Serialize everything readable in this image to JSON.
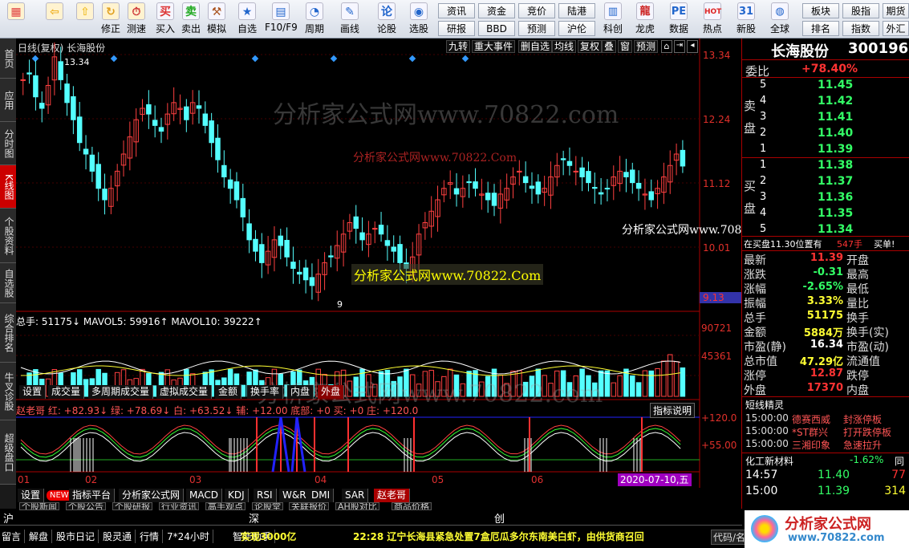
{
  "toolbar": {
    "buttons": [
      {
        "label": "",
        "icon": "app-grid-icon"
      },
      {
        "label": "",
        "icon": "back-arrow-icon"
      },
      {
        "label": "",
        "icon": "up-arrow-icon"
      },
      {
        "label": "修正",
        "icon": "refresh-icon"
      },
      {
        "label": "测速",
        "icon": "stopwatch-icon"
      },
      {
        "label": "买入",
        "icon": "buy-icon"
      },
      {
        "label": "卖出",
        "icon": "sell-icon"
      },
      {
        "label": "模拟",
        "icon": "gavel-icon"
      },
      {
        "label": "自选",
        "icon": "star-icon"
      },
      {
        "label": "F10/F9",
        "icon": "f10-icon"
      },
      {
        "label": "周期",
        "icon": "period-icon"
      },
      {
        "label": "画线",
        "icon": "pencil-icon"
      },
      {
        "label": "论股",
        "icon": "forum-icon"
      },
      {
        "label": "选股",
        "icon": "select-stock-icon"
      }
    ],
    "small_buttons": [
      "资讯",
      "资金",
      "竞价",
      "陆港",
      "研报",
      "BBD",
      "预测",
      "沪伦"
    ],
    "buttons2": [
      {
        "label": "科创",
        "icon": "chart-icon"
      },
      {
        "label": "龙虎",
        "icon": "dragon-icon"
      },
      {
        "label": "数据",
        "icon": "pe-icon"
      },
      {
        "label": "热点",
        "icon": "hot-icon"
      },
      {
        "label": "新股",
        "icon": "calendar-icon"
      },
      {
        "label": "全球",
        "icon": "globe-icon"
      }
    ],
    "small_buttons2": [
      "板块",
      "股指",
      "期货",
      "排名",
      "指数",
      "外汇"
    ]
  },
  "left_tabs": [
    "首页",
    "应用",
    "分时图",
    "K线图",
    "个股资料",
    "自选股",
    "综合排名",
    "牛叉诊股",
    "超级盘口"
  ],
  "chart": {
    "header_left": "日线(复权)  长海股份",
    "top_tabs": [
      "九转",
      "重大事件",
      "删自选",
      "均线",
      "复权",
      "叠",
      "窗",
      "预测"
    ],
    "price_axis": [
      "13.34",
      "12.24",
      "11.12",
      "10.01",
      "9.13"
    ],
    "volume_axis": [
      "90721",
      "45361"
    ],
    "indicator_axis": [
      "+120.0",
      "+55.00"
    ],
    "high_label": "13.34",
    "low_label": "9",
    "current_price_tag": "9.13",
    "vol_header": "总手: 51175↓  MAVOL5: 59916↑  MAVOL10: 39222↑",
    "vol_tabs": [
      "设置",
      "成交量",
      "多周期成交量",
      "虚拟成交量",
      "金额",
      "换手率",
      "内盘",
      "外盘"
    ],
    "ind_header": "赵老哥 红: +82.93↓ 绿: +78.69↓ 白: +63.52↓ 辅: +12.00 底部: +0 买: +0 庄: +120.0",
    "ind_help": "指标说明",
    "date_axis": [
      "01",
      "02",
      "03",
      "04",
      "05",
      "06"
    ],
    "date_tag": "2020-07-10,五",
    "bottom_tabs": [
      "设置",
      "NEW",
      "指标平台",
      "分析家公式网",
      "MACD",
      "KDJ",
      "RSI",
      "W&R",
      "DMI",
      "SAR",
      "赵老哥"
    ],
    "watermarks": [
      "分析家公式网www.70822.com",
      "分析家公式网www.70822.Com",
      "分析家公式网www.70822.Com",
      "分析家公式网www.70822.Com",
      "分析家公式网www.70822.com"
    ]
  },
  "panel": {
    "title": "长海股份",
    "code": "300196",
    "weibi_label": "委比",
    "weibi_value": "+78.40%",
    "sell_label": "卖盘",
    "buy_label": "买盘",
    "sells": [
      {
        "n": "5",
        "p": "11.45"
      },
      {
        "n": "4",
        "p": "11.42"
      },
      {
        "n": "3",
        "p": "11.41"
      },
      {
        "n": "2",
        "p": "11.40"
      },
      {
        "n": "1",
        "p": "11.39"
      }
    ],
    "buys": [
      {
        "n": "1",
        "p": "11.38"
      },
      {
        "n": "2",
        "p": "11.37"
      },
      {
        "n": "3",
        "p": "11.36"
      },
      {
        "n": "4",
        "p": "11.35"
      },
      {
        "n": "5",
        "p": "11.34"
      }
    ],
    "notice": "在买盘11.30位置有",
    "notice_qty": "547手",
    "notice_action": "买单!",
    "stats": [
      {
        "l": "最新",
        "v": "11.39",
        "r": "开盘"
      },
      {
        "l": "涨跌",
        "v": "-0.31",
        "r": "最高"
      },
      {
        "l": "涨幅",
        "v": "-2.65%",
        "r": "最低"
      },
      {
        "l": "振幅",
        "v": "3.33%",
        "r": "量比"
      },
      {
        "l": "总手",
        "v": "51175",
        "r": "换手"
      },
      {
        "l": "金额",
        "v": "5884万",
        "r": "换手(实)"
      },
      {
        "l": "市盈(静)",
        "v": "16.34",
        "r": "市盈(动)"
      },
      {
        "l": "总市值",
        "v": "47.29亿",
        "r": "流通值"
      },
      {
        "l": "涨停",
        "v": "12.87",
        "r": "跌停"
      },
      {
        "l": "外盘",
        "v": "17370",
        "r": "内盘"
      }
    ],
    "short_title": "短线精灵",
    "short_rows": [
      {
        "t": "15:00:00",
        "n": "德赛西威",
        "e": "封涨停板"
      },
      {
        "t": "15:00:00",
        "n": "*ST群兴",
        "e": "打开跌停板"
      },
      {
        "t": "15:00:00",
        "n": "三湘印象",
        "e": "急速拉升"
      }
    ],
    "industry": "化工新材料",
    "industry_pct": "-1.62%",
    "industry_tail": "同",
    "ticks": [
      {
        "t": "14:57",
        "p": "11.40",
        "v": "77"
      },
      {
        "t": "15:00",
        "p": "11.39",
        "v": "314"
      }
    ]
  },
  "status": {
    "index_tabs": [
      "沪",
      "深",
      "创"
    ],
    "news_tabs": [
      "个股新闻",
      "个股公告",
      "个股研报",
      "行业资讯",
      "高手观点",
      "论股堂",
      "关联报价",
      "AH股对比",
      "商品价格"
    ],
    "bottom_items": [
      "留言",
      "解盘",
      "股市日记",
      "股灵通",
      "行情",
      "7*24小时",
      "智能助手"
    ],
    "ticker_left": "实现3000亿",
    "ticker": "22:28 辽宁长海县紧急处置7盒厄瓜多尔东南美白虾，由供货商召回",
    "right_code": "代码/名",
    "logo_text": "分析家公式网",
    "logo_url": "www.70822.com"
  }
}
